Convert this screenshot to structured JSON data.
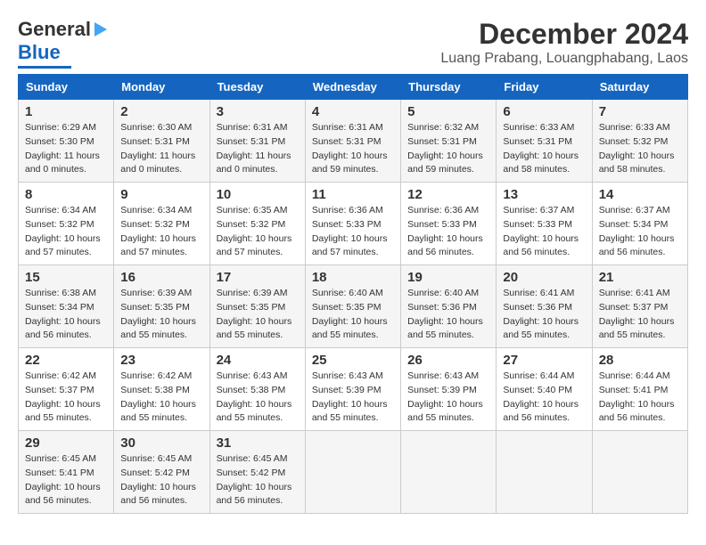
{
  "header": {
    "logo_line1": "General",
    "logo_line2": "Blue",
    "month": "December 2024",
    "location": "Luang Prabang, Louangphabang, Laos"
  },
  "weekdays": [
    "Sunday",
    "Monday",
    "Tuesday",
    "Wednesday",
    "Thursday",
    "Friday",
    "Saturday"
  ],
  "weeks": [
    [
      {
        "day": "1",
        "info": "Sunrise: 6:29 AM\nSunset: 5:30 PM\nDaylight: 11 hours\nand 0 minutes."
      },
      {
        "day": "2",
        "info": "Sunrise: 6:30 AM\nSunset: 5:31 PM\nDaylight: 11 hours\nand 0 minutes."
      },
      {
        "day": "3",
        "info": "Sunrise: 6:31 AM\nSunset: 5:31 PM\nDaylight: 11 hours\nand 0 minutes."
      },
      {
        "day": "4",
        "info": "Sunrise: 6:31 AM\nSunset: 5:31 PM\nDaylight: 10 hours\nand 59 minutes."
      },
      {
        "day": "5",
        "info": "Sunrise: 6:32 AM\nSunset: 5:31 PM\nDaylight: 10 hours\nand 59 minutes."
      },
      {
        "day": "6",
        "info": "Sunrise: 6:33 AM\nSunset: 5:31 PM\nDaylight: 10 hours\nand 58 minutes."
      },
      {
        "day": "7",
        "info": "Sunrise: 6:33 AM\nSunset: 5:32 PM\nDaylight: 10 hours\nand 58 minutes."
      }
    ],
    [
      {
        "day": "8",
        "info": "Sunrise: 6:34 AM\nSunset: 5:32 PM\nDaylight: 10 hours\nand 57 minutes."
      },
      {
        "day": "9",
        "info": "Sunrise: 6:34 AM\nSunset: 5:32 PM\nDaylight: 10 hours\nand 57 minutes."
      },
      {
        "day": "10",
        "info": "Sunrise: 6:35 AM\nSunset: 5:32 PM\nDaylight: 10 hours\nand 57 minutes."
      },
      {
        "day": "11",
        "info": "Sunrise: 6:36 AM\nSunset: 5:33 PM\nDaylight: 10 hours\nand 57 minutes."
      },
      {
        "day": "12",
        "info": "Sunrise: 6:36 AM\nSunset: 5:33 PM\nDaylight: 10 hours\nand 56 minutes."
      },
      {
        "day": "13",
        "info": "Sunrise: 6:37 AM\nSunset: 5:33 PM\nDaylight: 10 hours\nand 56 minutes."
      },
      {
        "day": "14",
        "info": "Sunrise: 6:37 AM\nSunset: 5:34 PM\nDaylight: 10 hours\nand 56 minutes."
      }
    ],
    [
      {
        "day": "15",
        "info": "Sunrise: 6:38 AM\nSunset: 5:34 PM\nDaylight: 10 hours\nand 56 minutes."
      },
      {
        "day": "16",
        "info": "Sunrise: 6:39 AM\nSunset: 5:35 PM\nDaylight: 10 hours\nand 55 minutes."
      },
      {
        "day": "17",
        "info": "Sunrise: 6:39 AM\nSunset: 5:35 PM\nDaylight: 10 hours\nand 55 minutes."
      },
      {
        "day": "18",
        "info": "Sunrise: 6:40 AM\nSunset: 5:35 PM\nDaylight: 10 hours\nand 55 minutes."
      },
      {
        "day": "19",
        "info": "Sunrise: 6:40 AM\nSunset: 5:36 PM\nDaylight: 10 hours\nand 55 minutes."
      },
      {
        "day": "20",
        "info": "Sunrise: 6:41 AM\nSunset: 5:36 PM\nDaylight: 10 hours\nand 55 minutes."
      },
      {
        "day": "21",
        "info": "Sunrise: 6:41 AM\nSunset: 5:37 PM\nDaylight: 10 hours\nand 55 minutes."
      }
    ],
    [
      {
        "day": "22",
        "info": "Sunrise: 6:42 AM\nSunset: 5:37 PM\nDaylight: 10 hours\nand 55 minutes."
      },
      {
        "day": "23",
        "info": "Sunrise: 6:42 AM\nSunset: 5:38 PM\nDaylight: 10 hours\nand 55 minutes."
      },
      {
        "day": "24",
        "info": "Sunrise: 6:43 AM\nSunset: 5:38 PM\nDaylight: 10 hours\nand 55 minutes."
      },
      {
        "day": "25",
        "info": "Sunrise: 6:43 AM\nSunset: 5:39 PM\nDaylight: 10 hours\nand 55 minutes."
      },
      {
        "day": "26",
        "info": "Sunrise: 6:43 AM\nSunset: 5:39 PM\nDaylight: 10 hours\nand 55 minutes."
      },
      {
        "day": "27",
        "info": "Sunrise: 6:44 AM\nSunset: 5:40 PM\nDaylight: 10 hours\nand 56 minutes."
      },
      {
        "day": "28",
        "info": "Sunrise: 6:44 AM\nSunset: 5:41 PM\nDaylight: 10 hours\nand 56 minutes."
      }
    ],
    [
      {
        "day": "29",
        "info": "Sunrise: 6:45 AM\nSunset: 5:41 PM\nDaylight: 10 hours\nand 56 minutes."
      },
      {
        "day": "30",
        "info": "Sunrise: 6:45 AM\nSunset: 5:42 PM\nDaylight: 10 hours\nand 56 minutes."
      },
      {
        "day": "31",
        "info": "Sunrise: 6:45 AM\nSunset: 5:42 PM\nDaylight: 10 hours\nand 56 minutes."
      },
      {
        "day": "",
        "info": ""
      },
      {
        "day": "",
        "info": ""
      },
      {
        "day": "",
        "info": ""
      },
      {
        "day": "",
        "info": ""
      }
    ]
  ]
}
